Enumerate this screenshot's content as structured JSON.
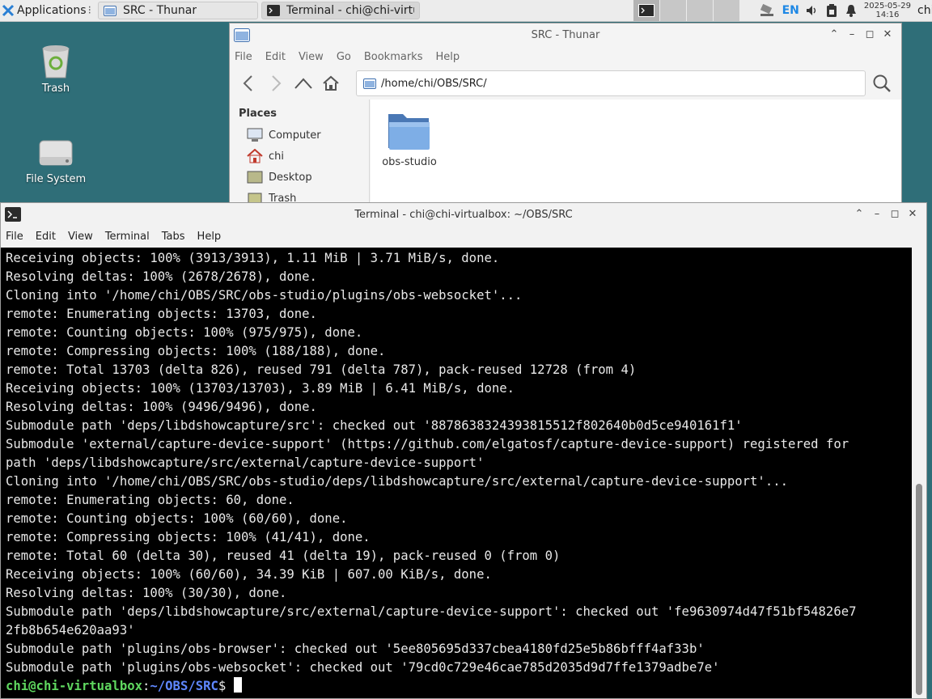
{
  "panel": {
    "applications_label": "Applications",
    "tasks": [
      {
        "label": "SRC - Thunar"
      },
      {
        "label": "Terminal - chi@chi-virtual..."
      }
    ],
    "lang": "EN",
    "clock_date": "2025-05-29",
    "clock_time": "14:16",
    "user_short": "chi"
  },
  "desktop": {
    "icons": [
      {
        "label": "Trash"
      },
      {
        "label": "File System"
      }
    ]
  },
  "thunar": {
    "title": "SRC - Thunar",
    "menu": [
      "File",
      "Edit",
      "View",
      "Go",
      "Bookmarks",
      "Help"
    ],
    "path": "/home/chi/OBS/SRC/",
    "places_header": "Places",
    "places": [
      {
        "label": "Computer",
        "icon": "computer-icon"
      },
      {
        "label": "chi",
        "icon": "home-icon"
      },
      {
        "label": "Desktop",
        "icon": "desktop-icon"
      },
      {
        "label": "Trash",
        "icon": "trash-icon"
      }
    ],
    "items": [
      {
        "label": "obs-studio",
        "icon": "folder-icon"
      }
    ]
  },
  "terminal": {
    "title": "Terminal - chi@chi-virtualbox: ~/OBS/SRC",
    "menu": [
      "File",
      "Edit",
      "View",
      "Terminal",
      "Tabs",
      "Help"
    ],
    "lines": [
      "Receiving objects: 100% (3913/3913), 1.11 MiB | 3.71 MiB/s, done.",
      "Resolving deltas: 100% (2678/2678), done.",
      "Cloning into '/home/chi/OBS/SRC/obs-studio/plugins/obs-websocket'...",
      "remote: Enumerating objects: 13703, done.",
      "remote: Counting objects: 100% (975/975), done.",
      "remote: Compressing objects: 100% (188/188), done.",
      "remote: Total 13703 (delta 826), reused 791 (delta 787), pack-reused 12728 (from 4)",
      "Receiving objects: 100% (13703/13703), 3.89 MiB | 6.41 MiB/s, done.",
      "Resolving deltas: 100% (9496/9496), done.",
      "Submodule path 'deps/libdshowcapture/src': checked out '8878638324393815512f802640b0d5ce940161f1'",
      "Submodule 'external/capture-device-support' (https://github.com/elgatosf/capture-device-support) registered for",
      "path 'deps/libdshowcapture/src/external/capture-device-support'",
      "Cloning into '/home/chi/OBS/SRC/obs-studio/deps/libdshowcapture/src/external/capture-device-support'...",
      "remote: Enumerating objects: 60, done.",
      "remote: Counting objects: 100% (60/60), done.",
      "remote: Compressing objects: 100% (41/41), done.",
      "remote: Total 60 (delta 30), reused 41 (delta 19), pack-reused 0 (from 0)",
      "Receiving objects: 100% (60/60), 34.39 KiB | 607.00 KiB/s, done.",
      "Resolving deltas: 100% (30/30), done.",
      "Submodule path 'deps/libdshowcapture/src/external/capture-device-support': checked out 'fe9630974d47f51bf54826e7",
      "2fb8b654e620aa93'",
      "Submodule path 'plugins/obs-browser': checked out '5ee805695d337cbea4180fd25e5b86bfff4af33b'",
      "Submodule path 'plugins/obs-websocket': checked out '79cd0c729e46cae785d2035d9d7ffe1379adbe7e'"
    ],
    "prompt_user": "chi@chi-virtualbox",
    "prompt_sep": ":",
    "prompt_path": "~/OBS/SRC",
    "prompt_symbol": "$ "
  }
}
